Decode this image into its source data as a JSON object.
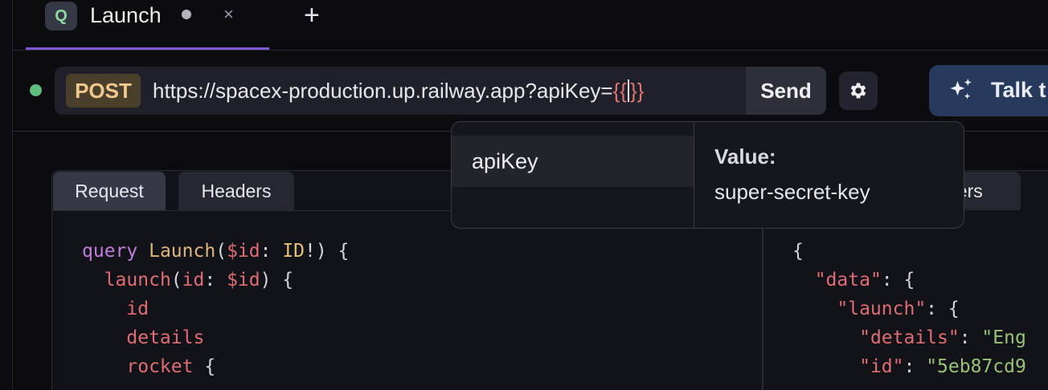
{
  "tab": {
    "icon_letter": "Q",
    "label": "Launch",
    "close_glyph": "×",
    "add_glyph": "+"
  },
  "request": {
    "method": "POST",
    "url_prefix": "https://spacex-production.up.railway.app?apiKey=",
    "url_template_open": "{{",
    "url_template_close": "}}",
    "send_label": "Send",
    "status_color": "#5fbd7e"
  },
  "assistant": {
    "label": "Talk t",
    "icon": "sparkle-icon"
  },
  "settings": {
    "icon": "gear-icon"
  },
  "panel_left": {
    "tabs": [
      "Request",
      "Headers"
    ]
  },
  "panel_right": {
    "tab_fragment": "ders"
  },
  "autocomplete": {
    "item": "apiKey",
    "value_label": "Value:",
    "value": "super-secret-key"
  },
  "query_code": [
    [
      {
        "t": "query",
        "c": "kw"
      },
      {
        "t": " ",
        "c": "pn"
      },
      {
        "t": "Launch",
        "c": "fn"
      },
      {
        "t": "(",
        "c": "pn"
      },
      {
        "t": "$id",
        "c": "vr"
      },
      {
        "t": ": ",
        "c": "pn"
      },
      {
        "t": "ID",
        "c": "ty"
      },
      {
        "t": "!) {",
        "c": "pn"
      }
    ],
    [
      {
        "t": "  ",
        "c": "pn"
      },
      {
        "t": "launch",
        "c": "vr"
      },
      {
        "t": "(",
        "c": "pn"
      },
      {
        "t": "id",
        "c": "vr"
      },
      {
        "t": ": ",
        "c": "pn"
      },
      {
        "t": "$id",
        "c": "vr"
      },
      {
        "t": ") {",
        "c": "pn"
      }
    ],
    [
      {
        "t": "    ",
        "c": "pn"
      },
      {
        "t": "id",
        "c": "vr"
      }
    ],
    [
      {
        "t": "    ",
        "c": "pn"
      },
      {
        "t": "details",
        "c": "vr"
      }
    ],
    [
      {
        "t": "    ",
        "c": "pn"
      },
      {
        "t": "rocket",
        "c": "vr"
      },
      {
        "t": " {",
        "c": "pn"
      }
    ]
  ],
  "response_code": [
    [
      {
        "t": "{",
        "c": "pn"
      }
    ],
    [
      {
        "t": "  ",
        "c": "pn"
      },
      {
        "t": "\"data\"",
        "c": "vr"
      },
      {
        "t": ": {",
        "c": "pn"
      }
    ],
    [
      {
        "t": "    ",
        "c": "pn"
      },
      {
        "t": "\"launch\"",
        "c": "vr"
      },
      {
        "t": ": {",
        "c": "pn"
      }
    ],
    [
      {
        "t": "      ",
        "c": "pn"
      },
      {
        "t": "\"details\"",
        "c": "vr"
      },
      {
        "t": ": ",
        "c": "pn"
      },
      {
        "t": "\"Eng",
        "c": "str"
      }
    ],
    [
      {
        "t": "      ",
        "c": "pn"
      },
      {
        "t": "\"id\"",
        "c": "vr"
      },
      {
        "t": ": ",
        "c": "pn"
      },
      {
        "t": "\"5eb87cd9",
        "c": "str"
      }
    ]
  ]
}
